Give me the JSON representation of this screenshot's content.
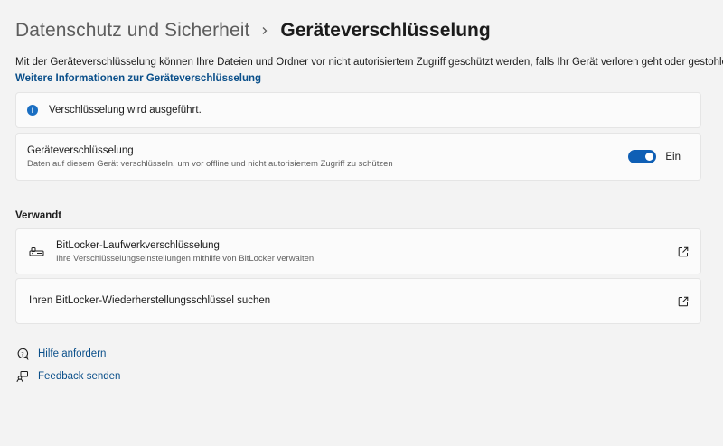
{
  "breadcrumb": {
    "parent": "Datenschutz und Sicherheit",
    "current": "Geräteverschlüsselung"
  },
  "description": "Mit der Geräteverschlüsselung können Ihre Dateien und Ordner vor nicht autorisiertem Zugriff geschützt werden, falls Ihr Gerät verloren geht oder gestohlen wird.",
  "more_info_link": "Weitere Informationen zur Geräteverschlüsselung",
  "info_bar": {
    "icon": "info-icon",
    "text": "Verschlüsselung wird ausgeführt."
  },
  "device_encryption": {
    "title": "Geräteverschlüsselung",
    "subtitle": "Daten auf diesem Gerät verschlüsseln, um vor offline und nicht autorisiertem Zugriff zu schützen",
    "toggle_state": "Ein",
    "enabled": true
  },
  "related": {
    "title": "Verwandt",
    "items": [
      {
        "icon": "bitlocker-key-icon",
        "title": "BitLocker-Laufwerkverschlüsselung",
        "subtitle": "Ihre Verschlüsselungseinstellungen mithilfe von BitLocker verwalten"
      },
      {
        "title": "Ihren BitLocker-Wiederherstellungsschlüssel suchen"
      }
    ]
  },
  "help": {
    "get_help": "Hilfe anfordern",
    "feedback": "Feedback senden"
  },
  "colors": {
    "background": "#f3f3f3",
    "card": "#fbfbfb",
    "accent": "#0f5fb5",
    "link": "#0a4f8a",
    "info": "#1a6ec2"
  }
}
